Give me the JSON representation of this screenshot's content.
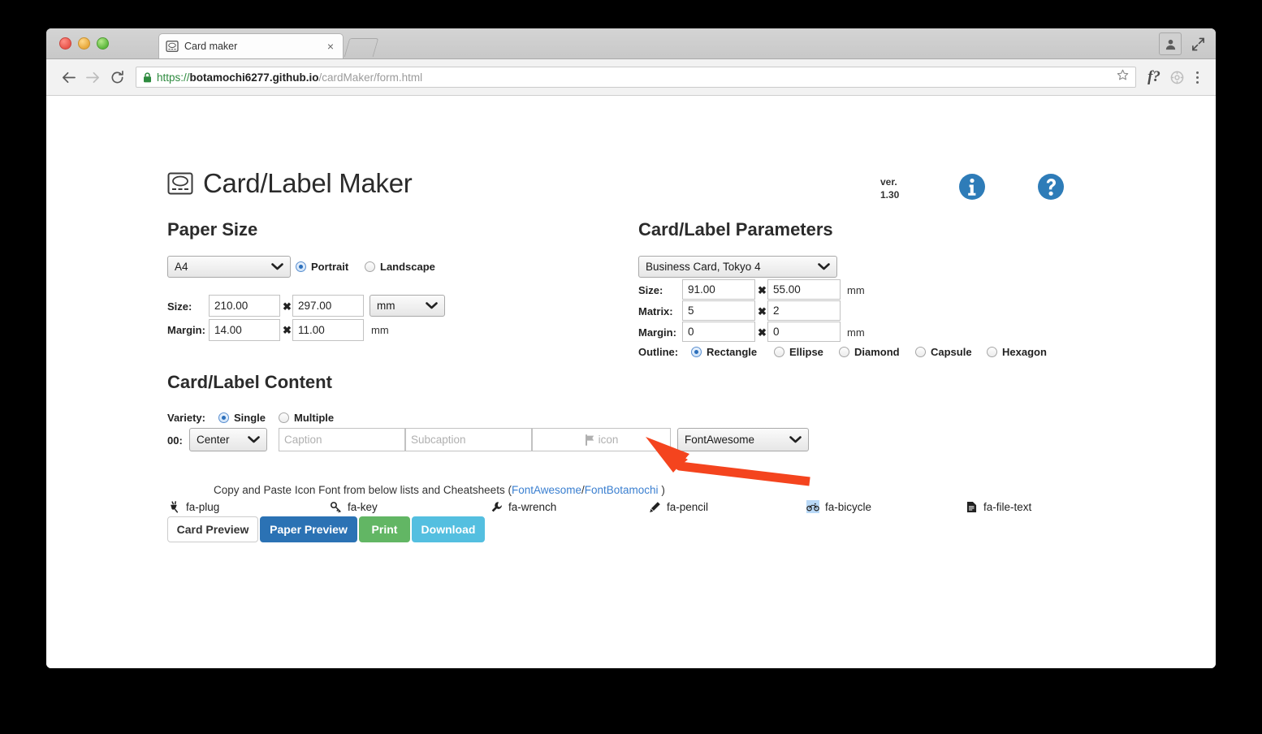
{
  "browser": {
    "tab_title": "Card maker",
    "tab_close": "×",
    "url_scheme": "https://",
    "url_host": "botamochi6277.github.io",
    "url_path": "/cardMaker/form.html",
    "extension_label": "f?"
  },
  "app": {
    "title": "Card/Label Maker",
    "version_label": "ver.",
    "version_number": "1.30"
  },
  "paper": {
    "heading": "Paper Size",
    "preset": "A4",
    "orientation": [
      {
        "label": "Portrait",
        "selected": true
      },
      {
        "label": "Landscape",
        "selected": false
      }
    ],
    "size_label": "Size:",
    "size_w": "210.00",
    "size_h": "297.00",
    "unit_select": "mm",
    "margin_label": "Margin:",
    "margin_w": "14.00",
    "margin_h": "11.00",
    "margin_unit": "mm",
    "times": "✖"
  },
  "params": {
    "heading": "Card/Label Parameters",
    "preset": "Business Card, Tokyo 4",
    "size_label": "Size:",
    "size_w": "91.00",
    "size_h": "55.00",
    "size_unit": "mm",
    "matrix_label": "Matrix:",
    "matrix_cols": "5",
    "matrix_rows": "2",
    "margin_label": "Margin:",
    "margin_w": "0",
    "margin_h": "0",
    "margin_unit": "mm",
    "outline_label": "Outline:",
    "outline": [
      {
        "label": "Rectangle",
        "selected": true
      },
      {
        "label": "Ellipse",
        "selected": false
      },
      {
        "label": "Diamond",
        "selected": false
      },
      {
        "label": "Capsule",
        "selected": false
      },
      {
        "label": "Hexagon",
        "selected": false
      }
    ]
  },
  "content": {
    "heading": "Card/Label Content",
    "variety_label": "Variety:",
    "variety": [
      {
        "label": "Single",
        "selected": true
      },
      {
        "label": "Multiple",
        "selected": false
      }
    ],
    "row_index": "00:",
    "align_select": "Center",
    "caption_placeholder": "Caption",
    "subcaption_placeholder": "Subcaption",
    "icon_placeholder": "icon",
    "font_select": "FontAwesome",
    "note_text": "Copy and Paste Icon Font from below lists and Cheatsheets (",
    "note_link1": "FontAwesome",
    "note_sep": "/",
    "note_link2": "FontBotamochi",
    "note_tail": " )",
    "icons": [
      {
        "name": "fa-plug",
        "highlighted": false
      },
      {
        "name": "fa-key",
        "highlighted": false
      },
      {
        "name": "fa-wrench",
        "highlighted": false
      },
      {
        "name": "fa-pencil",
        "highlighted": false
      },
      {
        "name": "fa-bicycle",
        "highlighted": true
      },
      {
        "name": "fa-file-text",
        "highlighted": false
      }
    ],
    "buttons": [
      {
        "label": "Card Preview",
        "style": "white"
      },
      {
        "label": "Paper Preview",
        "style": "blue"
      },
      {
        "label": "Print",
        "style": "green"
      },
      {
        "label": "Download",
        "style": "cyan"
      }
    ]
  },
  "annotation": {
    "arrow_color": "#f4441e",
    "points_to": "icon-input"
  },
  "colors": {
    "link": "#3a7fd0",
    "accent_blue": "#2b72b4",
    "accent_green": "#62b664",
    "accent_cyan": "#54bfe0",
    "brand_icon": "#2e7cb8"
  }
}
